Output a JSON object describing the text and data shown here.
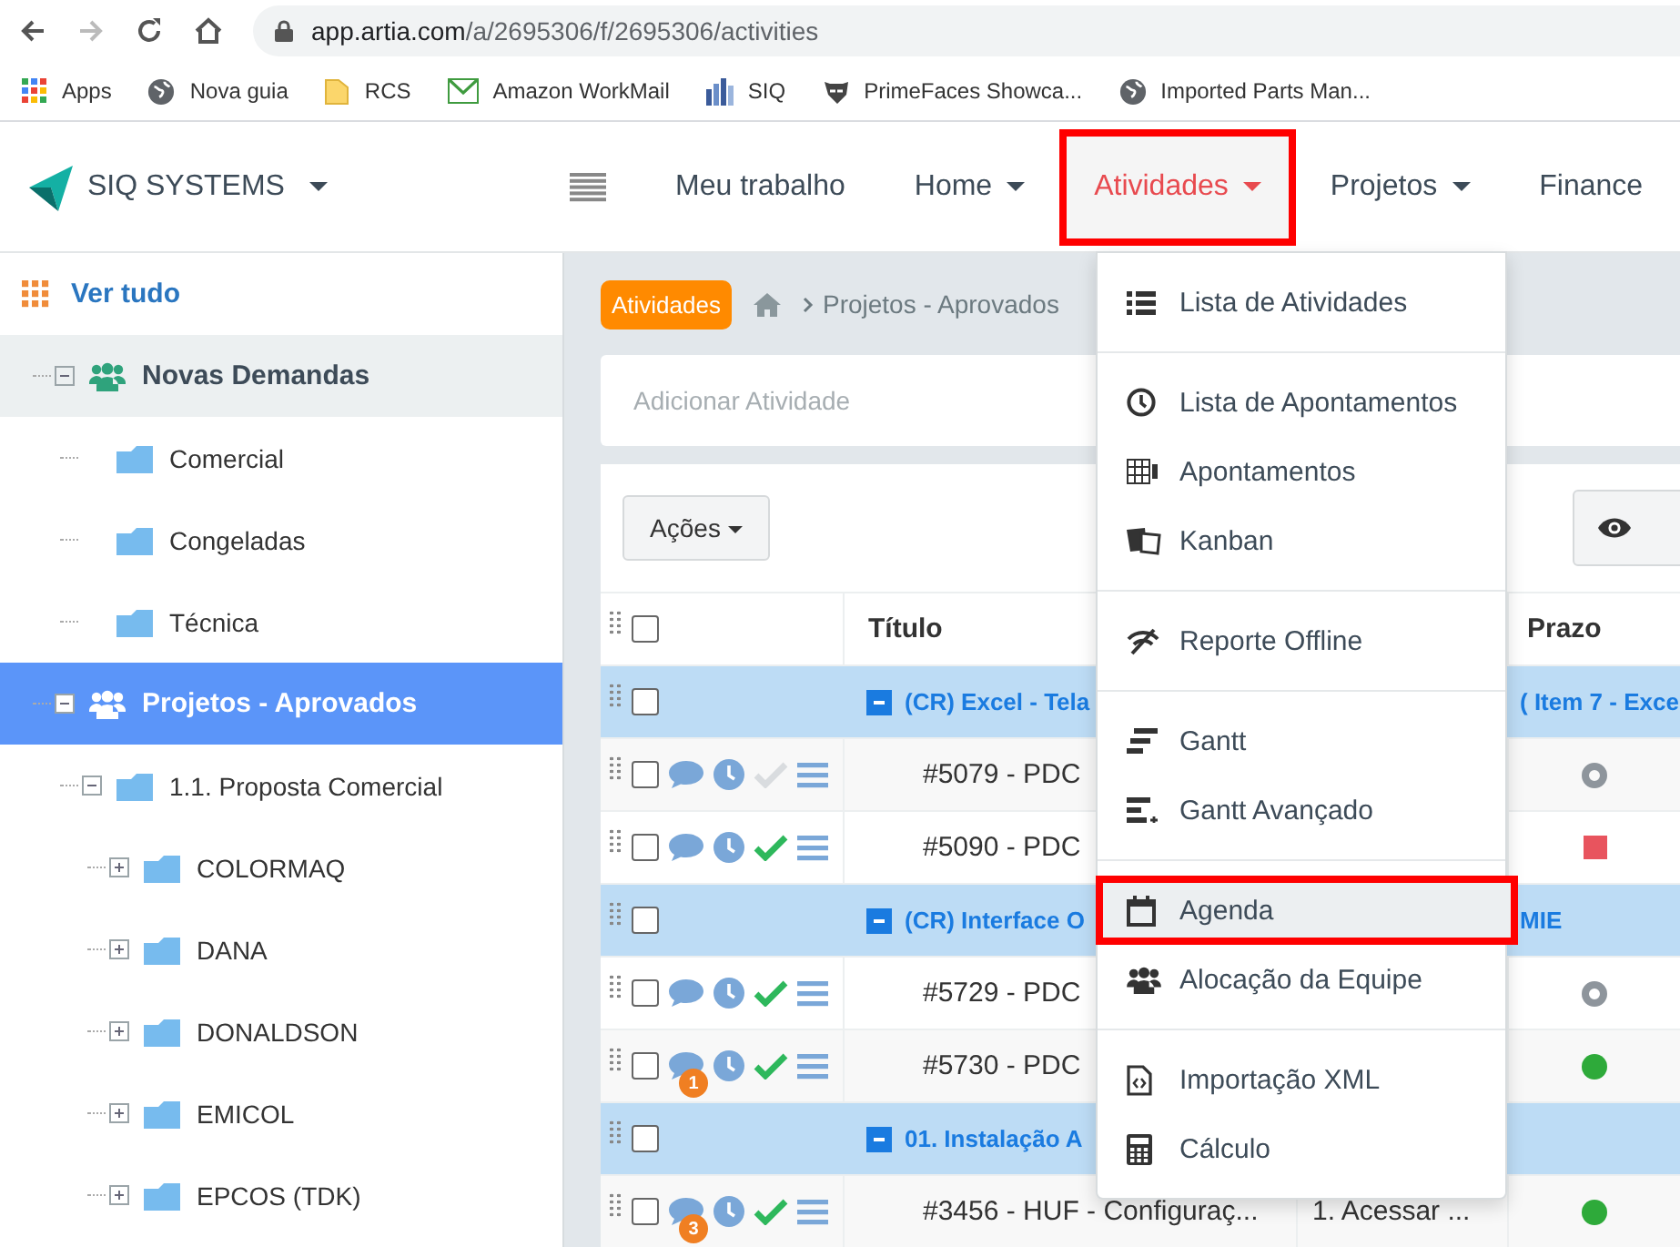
{
  "browser": {
    "url_host": "app.artia.com",
    "url_path": "/a/2695306/f/2695306/activities"
  },
  "bookmarks": [
    {
      "kind": "apps",
      "label": "Apps"
    },
    {
      "kind": "globe",
      "label": "Nova guia"
    },
    {
      "kind": "folder",
      "label": "RCS"
    },
    {
      "kind": "mail",
      "label": "Amazon WorkMail"
    },
    {
      "kind": "bars",
      "label": "SIQ"
    },
    {
      "kind": "mask",
      "label": "PrimeFaces Showca..."
    },
    {
      "kind": "globe",
      "label": "Imported Parts Man..."
    }
  ],
  "header": {
    "brand": "SIQ SYSTEMS",
    "nav": [
      {
        "label": "Meu trabalho",
        "caret": false,
        "selected": false,
        "highlight": false
      },
      {
        "label": "Home",
        "caret": true,
        "selected": false,
        "highlight": false
      },
      {
        "label": "Atividades",
        "caret": true,
        "selected": true,
        "highlight": true
      },
      {
        "label": "Projetos",
        "caret": true,
        "selected": false,
        "highlight": false
      },
      {
        "label": "Finance",
        "caret": false,
        "selected": false,
        "highlight": false
      }
    ]
  },
  "sidebar": {
    "view_all": "Ver tudo",
    "tree": [
      {
        "kind": "group",
        "label": "Novas Demandas",
        "expanded": true,
        "selected": false,
        "hovered": true,
        "children": [
          {
            "kind": "folder",
            "label": "Comercial",
            "selected": false,
            "hovered": false
          },
          {
            "kind": "folder",
            "label": "Congeladas",
            "selected": false,
            "hovered": false
          },
          {
            "kind": "folder",
            "label": "Técnica",
            "selected": false,
            "hovered": false
          }
        ]
      },
      {
        "kind": "group",
        "label": "Projetos - Aprovados",
        "expanded": true,
        "selected": true,
        "hovered": false,
        "children": [
          {
            "kind": "folder",
            "label": "1.1. Proposta Comercial",
            "expanded": true,
            "selected": false,
            "hovered": false,
            "children": [
              {
                "kind": "folder",
                "label": "COLORMAQ",
                "expanded": false,
                "selected": false,
                "hovered": false
              },
              {
                "kind": "folder",
                "label": "DANA",
                "expanded": false,
                "selected": false,
                "hovered": false
              },
              {
                "kind": "folder",
                "label": "DONALDSON",
                "expanded": false,
                "selected": false,
                "hovered": false
              },
              {
                "kind": "folder",
                "label": "EMICOL",
                "expanded": false,
                "selected": false,
                "hovered": false
              },
              {
                "kind": "folder",
                "label": "EPCOS (TDK)",
                "expanded": false,
                "selected": false,
                "hovered": false
              }
            ]
          }
        ]
      }
    ]
  },
  "breadcrumb": {
    "badge": "Atividades",
    "path": "Projetos - Aprovados"
  },
  "add_activity": {
    "placeholder": "Adicionar Atividade"
  },
  "toolbar": {
    "actions": "Ações"
  },
  "table": {
    "header": {
      "title": "Título",
      "deadline": "Prazo",
      "checked": false
    },
    "rows": [
      {
        "kind": "group",
        "title": "(CR) Excel - Tela",
        "deadline_text": "( Item 7 - Exce",
        "checked": false
      },
      {
        "kind": "task",
        "title": "#5079 - PDC",
        "checked": false,
        "done": false,
        "marker": {
          "kind": "ring",
          "color": "#8e959c"
        }
      },
      {
        "kind": "task",
        "title": "#5090 - PDC",
        "checked": false,
        "done": true,
        "marker": {
          "kind": "square",
          "color": "#e8545e"
        }
      },
      {
        "kind": "group",
        "title": "(CR) Interface O",
        "deadline_text": "MIE",
        "checked": false
      },
      {
        "kind": "task",
        "title": "#5729 - PDC",
        "checked": false,
        "done": true,
        "marker": {
          "kind": "ring",
          "color": "#8e959c"
        }
      },
      {
        "kind": "task",
        "title": "#5730 - PDC",
        "checked": false,
        "done": true,
        "comment_count": "1",
        "marker": {
          "kind": "dot",
          "color": "#2eaa3a"
        }
      },
      {
        "kind": "group",
        "title": "01. Instalação A",
        "checked": false
      },
      {
        "kind": "task",
        "title": "#3456 - HUF - Configuraç...",
        "step": "1. Acessar ...",
        "checked": false,
        "done": true,
        "comment_count": "3",
        "marker": {
          "kind": "dot",
          "color": "#2eaa3a"
        }
      }
    ]
  },
  "menu": {
    "sections": [
      [
        {
          "kind": "list",
          "label": "Lista de Atividades",
          "highlight": false
        }
      ],
      [
        {
          "kind": "clock",
          "label": "Lista de Apontamentos",
          "highlight": false
        },
        {
          "kind": "grid",
          "label": "Apontamentos",
          "highlight": false
        },
        {
          "kind": "kanban",
          "label": "Kanban",
          "highlight": false
        }
      ],
      [
        {
          "kind": "offline",
          "label": "Reporte Offline",
          "highlight": false
        }
      ],
      [
        {
          "kind": "gantt",
          "label": "Gantt",
          "highlight": false
        },
        {
          "kind": "gantt2",
          "label": "Gantt Avançado",
          "highlight": false
        }
      ],
      [
        {
          "kind": "calendar",
          "label": "Agenda",
          "highlight": true
        },
        {
          "kind": "team",
          "label": "Alocação da Equipe",
          "highlight": false
        }
      ],
      [
        {
          "kind": "xml",
          "label": "Importação XML",
          "highlight": false
        },
        {
          "kind": "calc",
          "label": "Cálculo",
          "highlight": false
        }
      ]
    ]
  }
}
